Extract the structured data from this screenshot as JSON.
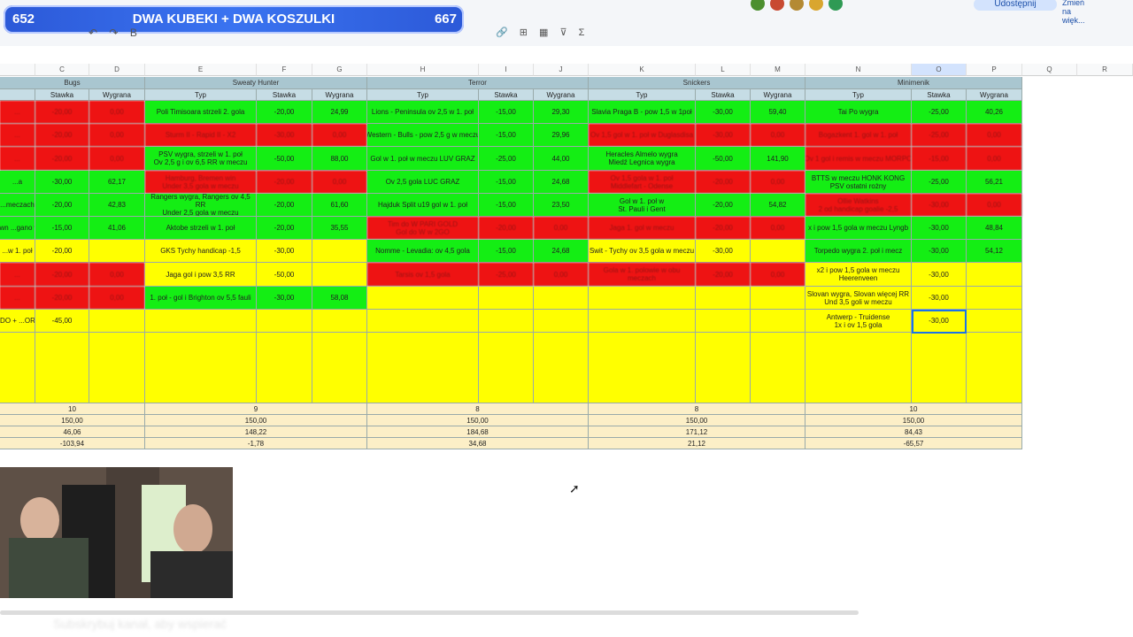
{
  "banner": {
    "left_count": "652",
    "title": "DWA KUBEKI + DWA KOSZULKI",
    "right_count": "667"
  },
  "toolbar": {
    "share_label": "Udostępnij",
    "expand_label": "Zmień na więk..."
  },
  "columns": [
    "C",
    "D",
    "E",
    "F",
    "G",
    "H",
    "I",
    "J",
    "K",
    "L",
    "M",
    "N",
    "O",
    "P",
    "Q",
    "R"
  ],
  "players": [
    "Bugs",
    "Sweaty Hunter",
    "Terror",
    "Snickers",
    "Minimenik"
  ],
  "subheaders": {
    "typ": "Typ",
    "stawka": "Stawka",
    "wygrana": "Wygrana"
  },
  "bugs": {
    "rows": [
      {
        "typ": "...",
        "stawka": "-20,00",
        "wygrana": "0,00",
        "c": "r"
      },
      {
        "typ": "...",
        "stawka": "-20,00",
        "wygrana": "0,00",
        "c": "r"
      },
      {
        "typ": "...",
        "stawka": "-20,00",
        "wygrana": "0,00",
        "c": "r"
      },
      {
        "typ": "...a",
        "stawka": "-30,00",
        "wygrana": "62,17",
        "c": "g"
      },
      {
        "typ": "...meczach",
        "stawka": "-20,00",
        "wygrana": "42,83",
        "c": "g"
      },
      {
        "typ": "...own ...gano win",
        "stawka": "-15,00",
        "wygrana": "41,06",
        "c": "g"
      },
      {
        "typ": "...w 1. poł",
        "stawka": "-20,00",
        "wygrana": "",
        "c": "y"
      },
      {
        "typ": "...",
        "stawka": "-20,00",
        "wygrana": "0,00",
        "c": "r"
      },
      {
        "typ": "...",
        "stawka": "-20,00",
        "wygrana": "0,00",
        "c": "r"
      },
      {
        "typ": "...DO + ...ORD",
        "stawka": "-45,00",
        "wygrana": "",
        "c": "y"
      }
    ],
    "summary": [
      "10",
      "150,00",
      "46,06",
      "-103,94"
    ]
  },
  "sweaty": {
    "rows": [
      {
        "typ": "Poli Timisoara strzeli 2. gola",
        "stawka": "-20,00",
        "wygrana": "24,99",
        "c": "g"
      },
      {
        "typ": "Sturm II - Rapid II - X2",
        "stawka": "-30,00",
        "wygrana": "0,00",
        "c": "r"
      },
      {
        "typ": "PSV wygra, strzeli w 1. poł\nOv 2,5 g i ov 6,5 RR w meczu",
        "stawka": "-50,00",
        "wygrana": "88,00",
        "c": "g"
      },
      {
        "typ": "Hamburg, Bremen win\nUnder 3,5 gola w meczu",
        "stawka": "-20,00",
        "wygrana": "0,00",
        "c": "r"
      },
      {
        "typ": "Rangers wygra, Rangers ov 4,5 RR\nUnder 2,5 gola w meczu",
        "stawka": "-20,00",
        "wygrana": "61,60",
        "c": "g"
      },
      {
        "typ": "Aktobe strzeli w 1. poł",
        "stawka": "-20,00",
        "wygrana": "35,55",
        "c": "g"
      },
      {
        "typ": "GKS Tychy handicap -1,5",
        "stawka": "-30,00",
        "wygrana": "",
        "c": "y"
      },
      {
        "typ": "Jaga gol i pow 3,5 RR",
        "stawka": "-50,00",
        "wygrana": "",
        "c": "y"
      },
      {
        "typ": "1. poł - gol i Brighton ov 5,5 fauli",
        "stawka": "-30,00",
        "wygrana": "58,08",
        "c": "g"
      },
      {
        "typ": "",
        "stawka": "",
        "wygrana": "",
        "c": "y"
      }
    ],
    "summary": [
      "9",
      "150,00",
      "148,22",
      "-1,78"
    ]
  },
  "terror": {
    "rows": [
      {
        "typ": "Lions - Peninsula ov 2,5 w 1. poł",
        "stawka": "-15,00",
        "wygrana": "29,30",
        "c": "g"
      },
      {
        "typ": "Western - Bulls - pow 2,5 g w meczu",
        "stawka": "-15,00",
        "wygrana": "29,96",
        "c": "g"
      },
      {
        "typ": "Gol w 1. poł w meczu LUV GRAZ",
        "stawka": "-25,00",
        "wygrana": "44,00",
        "c": "g"
      },
      {
        "typ": "Ov 2,5 gola LUC GRAZ",
        "stawka": "-15,00",
        "wygrana": "24,68",
        "c": "g"
      },
      {
        "typ": "Hajduk Split u19 gol w 1. poł",
        "stawka": "-15,00",
        "wygrana": "23,50",
        "c": "g"
      },
      {
        "typ": "Tim do W PARI GOLD\nGol do W w 2GO",
        "stawka": "-20,00",
        "wygrana": "0,00",
        "c": "r"
      },
      {
        "typ": "Nomme - Levadia: ov 4,5 gola",
        "stawka": "-15,00",
        "wygrana": "24,68",
        "c": "g"
      },
      {
        "typ": "Tarsis ov 1,5 gola",
        "stawka": "-25,00",
        "wygrana": "0,00",
        "c": "r"
      },
      {
        "typ": "",
        "stawka": "",
        "wygrana": "",
        "c": "y"
      },
      {
        "typ": "",
        "stawka": "",
        "wygrana": "",
        "c": "y"
      }
    ],
    "summary": [
      "8",
      "150,00",
      "184,68",
      "34,68"
    ]
  },
  "snickers": {
    "rows": [
      {
        "typ": "Slavia Praga B - pow 1,5 w 1poł",
        "stawka": "-30,00",
        "wygrana": "59,40",
        "c": "g"
      },
      {
        "typ": "Ov 1,5 gol w 1. poł w Duglasdisa",
        "stawka": "-30,00",
        "wygrana": "0,00",
        "c": "r"
      },
      {
        "typ": "Heracles Almelo wygra\nMiedź Legnica wygra",
        "stawka": "-50,00",
        "wygrana": "141,90",
        "c": "g"
      },
      {
        "typ": "Ov 1,5 gola w 1. poł\nMiddlefart - Odense",
        "stawka": "-20,00",
        "wygrana": "0,00",
        "c": "r"
      },
      {
        "typ": "Gol w 1. poł w\nSt. Pauli i Gent",
        "stawka": "-20,00",
        "wygrana": "54,82",
        "c": "g"
      },
      {
        "typ": "Jaga 1. gol w meczu",
        "stawka": "-20,00",
        "wygrana": "0,00",
        "c": "r"
      },
      {
        "typ": "Swit - Tychy ov 3,5 gola w meczu",
        "stawka": "-30,00",
        "wygrana": "",
        "c": "y"
      },
      {
        "typ": "Gola w 1. polowie w obu\nmeczach",
        "stawka": "-20,00",
        "wygrana": "0,00",
        "c": "r"
      },
      {
        "typ": "",
        "stawka": "",
        "wygrana": "",
        "c": "y"
      },
      {
        "typ": "",
        "stawka": "",
        "wygrana": "",
        "c": "y"
      }
    ],
    "summary": [
      "8",
      "150,00",
      "171,12",
      "21,12"
    ]
  },
  "minimenik": {
    "rows": [
      {
        "typ": "Tai Po wygra",
        "stawka": "-25,00",
        "wygrana": "40,26",
        "c": "g"
      },
      {
        "typ": "Bogazkent 1. gol w 1. poł",
        "stawka": "-25,00",
        "wygrana": "0,00",
        "c": "r"
      },
      {
        "typ": "Ov 1 gol i remis w meczu MORPO",
        "stawka": "-15,00",
        "wygrana": "0,00",
        "c": "r"
      },
      {
        "typ": "BTTS w meczu HONK KONG\nPSV ostatni rożny",
        "stawka": "-25,00",
        "wygrana": "56,21",
        "c": "g"
      },
      {
        "typ": "Ollie Watkins\n2 od handicap goalie -2,5",
        "stawka": "-30,00",
        "wygrana": "0,00",
        "c": "r"
      },
      {
        "typ": "x i pow 1,5 gola w meczu Lyngb",
        "stawka": "-30,00",
        "wygrana": "48,84",
        "c": "g"
      },
      {
        "typ": "Torpedo wygra 2. poł i mecz",
        "stawka": "-30,00",
        "wygrana": "54,12",
        "c": "g"
      },
      {
        "typ": "x2 i pow 1,5 gola w meczu\nHeerenveen",
        "stawka": "-30,00",
        "wygrana": "",
        "c": "y"
      },
      {
        "typ": "Slovan wygra, Slovan więcej RR\nUnd 3,5 goli w meczu",
        "stawka": "-30,00",
        "wygrana": "",
        "c": "y"
      },
      {
        "typ": "Antwerp - Truidense\n1x i ov 1,5 gola",
        "stawka": "-30,00",
        "wygrana": "",
        "c": "y"
      }
    ],
    "summary": [
      "10",
      "150,00",
      "84,43",
      "-65,57"
    ]
  },
  "footer_text": "Subskrybuj kanał, aby wspierać"
}
